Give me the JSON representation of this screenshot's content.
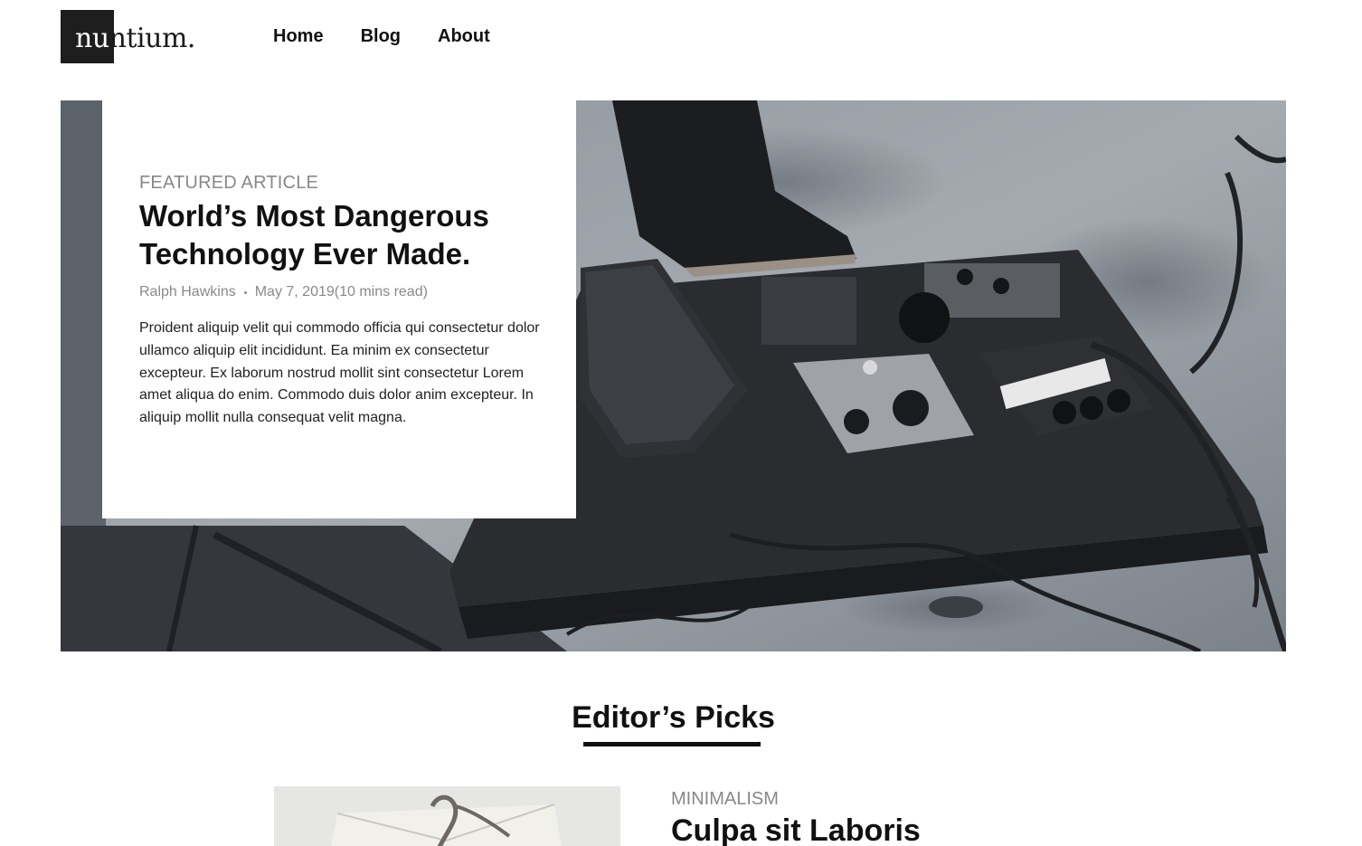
{
  "header": {
    "logo": {
      "dark_part": "nu",
      "rest": "ntium."
    },
    "nav": [
      {
        "label": "Home"
      },
      {
        "label": "Blog"
      },
      {
        "label": "About"
      }
    ]
  },
  "featured": {
    "label": "FEATURED ARTICLE",
    "title": "World’s Most Dangerous Technology Ever Made.",
    "author": "Ralph Hawkins",
    "date": "May 7, 2019",
    "read_time": "(10 mins read)",
    "excerpt": "Proident aliquip velit qui commodo officia qui consectetur dolor ullamco aliquip elit incididunt. Ea minim ex consectetur excepteur. Ex laborum nostrud mollit sint consectetur Lorem amet aliqua do enim. Commodo duis dolor anim excepteur. In aliquip mollit nulla consequat velit magna.",
    "image_subject": "guitar-pedalboard-photo"
  },
  "editors_picks": {
    "heading": "Editor’s Picks",
    "items": [
      {
        "category": "MINIMALISM",
        "title": "Culpa sit Laboris",
        "image_subject": "envelope-photo"
      }
    ]
  },
  "colors": {
    "text": "#111111",
    "muted": "#888888",
    "logo_box": "#1e1e1e"
  }
}
